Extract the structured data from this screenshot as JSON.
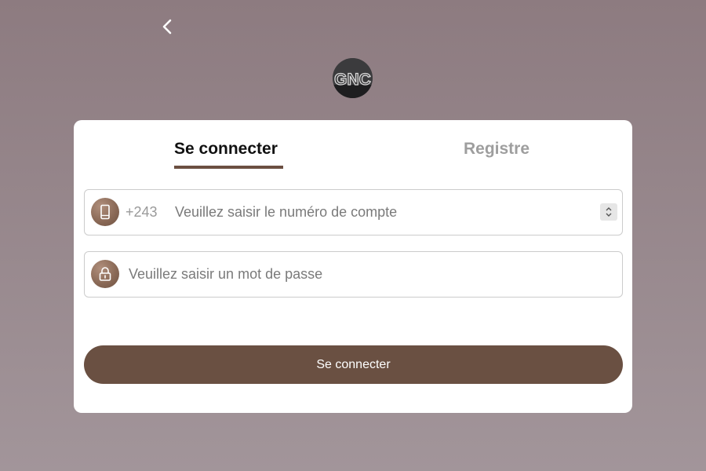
{
  "header": {
    "back_icon": "chevron-left-icon",
    "logo_text": "GNC"
  },
  "tabs": [
    {
      "label": "Se connecter",
      "active": true
    },
    {
      "label": "Registre",
      "active": false
    }
  ],
  "form": {
    "account": {
      "icon": "phone-icon",
      "prefix": "+243",
      "placeholder": "Veuillez saisir le numéro de compte",
      "value": ""
    },
    "password": {
      "icon": "lock-icon",
      "placeholder": "Veuillez saisir un mot de passe",
      "value": ""
    },
    "submit_label": "Se connecter"
  },
  "colors": {
    "background_top": "#8d7b80",
    "background_bottom": "#a2959a",
    "accent": "#6a5042",
    "tab_active": "#111111",
    "tab_inactive": "#9e9e9e"
  }
}
